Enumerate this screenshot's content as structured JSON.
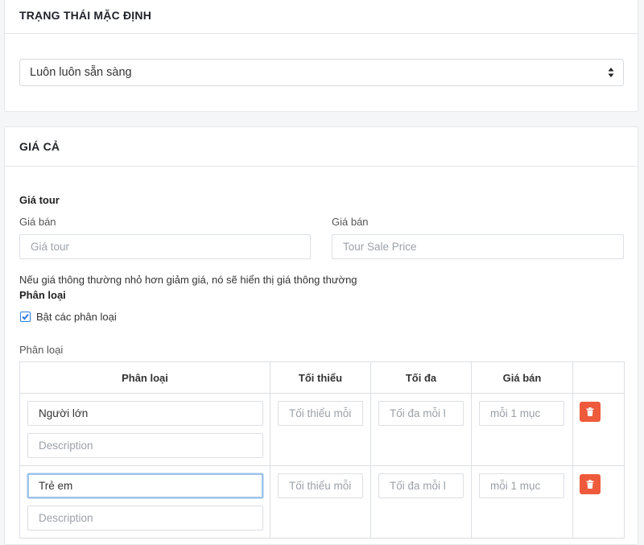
{
  "status_panel": {
    "title": "TRẠNG THÁI MẶC ĐỊNH",
    "select_value": "Luôn luôn sẵn sàng"
  },
  "price_panel": {
    "title": "GIÁ CẢ",
    "tour_price_heading": "Giá tour",
    "price_label_left": "Giá bán",
    "price_label_right": "Giá bán",
    "price_placeholder": "Giá tour",
    "sale_price_placeholder": "Tour Sale Price",
    "hint": "Nếu giá thông thường nhỏ hơn giảm giá, nó sẽ hiển thị giá thông thường",
    "category_heading": "Phân loại",
    "enable_categories_label": "Bật các phân loại",
    "enable_categories_checked": true,
    "category_table_label": "Phân loại",
    "table": {
      "columns": [
        "Phân loại",
        "Tối thiểu",
        "Tối đa",
        "Giá bán",
        ""
      ],
      "rows": [
        {
          "name": "Người lớn",
          "description_placeholder": "Description",
          "min_placeholder": "Tối thiểu mỗi",
          "max_placeholder": "Tối đa mỗi l",
          "price_placeholder": "mỗi 1 mục"
        },
        {
          "name": "Trẻ em",
          "description_placeholder": "Description",
          "min_placeholder": "Tối thiểu mỗi",
          "max_placeholder": "Tối đa mỗi l",
          "price_placeholder": "mỗi 1 mục"
        }
      ]
    }
  },
  "colors": {
    "delete_button": "#ee5a3c",
    "focus_ring": "#9cc3ea",
    "checkbox": "#2c7be5"
  }
}
